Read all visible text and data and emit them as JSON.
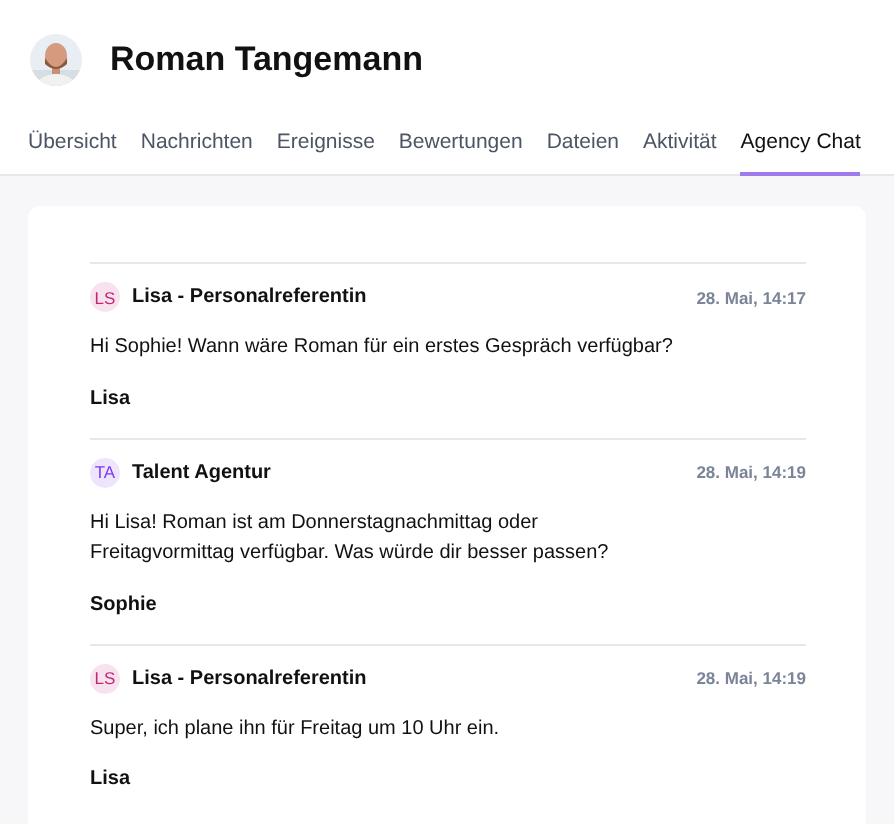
{
  "profile": {
    "name": "Roman Tangemann"
  },
  "tabs": [
    {
      "label": "Übersicht",
      "selected": false
    },
    {
      "label": "Nachrichten",
      "selected": false
    },
    {
      "label": "Ereignisse",
      "selected": false
    },
    {
      "label": "Bewertungen",
      "selected": false
    },
    {
      "label": "Dateien",
      "selected": false
    },
    {
      "label": "Aktivität",
      "selected": false
    },
    {
      "label": "Agency Chat",
      "selected": true
    }
  ],
  "messages": [
    {
      "initials": "LS",
      "color": "#c0267a",
      "sender": "Lisa - Personalreferentin",
      "time": "28. Mai, 14:17",
      "lines": [
        "Hi Sophie! Wann wäre Roman für ein erstes Gespräch verfügbar?"
      ],
      "signature": "Lisa"
    },
    {
      "initials": "TA",
      "color": "#7c3aed",
      "sender": "Talent Agentur",
      "time": "28. Mai, 14:19",
      "lines": [
        "Hi Lisa! Roman ist am Donnerstagnachmittag oder",
        "Freitagvormittag verfügbar. Was würde dir besser passen?"
      ],
      "signature": "Sophie"
    },
    {
      "initials": "LS",
      "color": "#c0267a",
      "sender": "Lisa - Personalreferentin",
      "time": "28. Mai, 14:19",
      "lines": [
        "Super, ich plane ihn für Freitag um 10 Uhr ein."
      ],
      "signature": "Lisa"
    }
  ]
}
